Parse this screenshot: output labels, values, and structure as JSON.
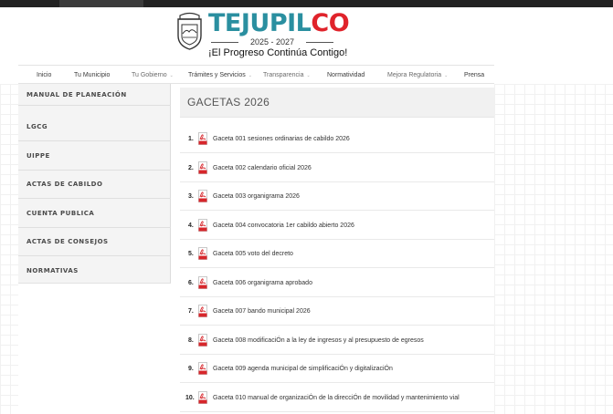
{
  "header": {
    "logo_brand_main": "TEJUPIL",
    "logo_brand_accent": "CO",
    "logo_years": "2025 - 2027",
    "logo_slogan": "¡El Progreso Continúa Contigo!"
  },
  "nav": {
    "items": [
      {
        "label": "Inicio"
      },
      {
        "label": "Tu Municipio"
      },
      {
        "label": "Tu Gobierno"
      },
      {
        "label": "Trámites y Servicios"
      },
      {
        "label": "Transparencia"
      },
      {
        "label": "Normatividad"
      },
      {
        "label": "Mejora Regulatoria"
      },
      {
        "label": "Prensa"
      }
    ]
  },
  "sidebar": {
    "items": [
      {
        "label": "MANUAL DE PLANEACIÓN"
      },
      {
        "label": "LGCG"
      },
      {
        "label": "UIPPE"
      },
      {
        "label": "ACTAS DE CABILDO"
      },
      {
        "label": "CUENTA PUBLICA"
      },
      {
        "label": "ACTAS DE CONSEJOS"
      },
      {
        "label": "NORMATIVAS"
      }
    ]
  },
  "main": {
    "title": "GACETAS 2026",
    "documents": [
      {
        "number": "1.",
        "title": "Gaceta 001 sesiones ordinarias de cabildo 2026",
        "icon": "pdf-icon"
      },
      {
        "number": "2.",
        "title": "Gaceta 002 calendario oficial 2026",
        "icon": "pdf-icon"
      },
      {
        "number": "3.",
        "title": "Gaceta 003 organigrama 2026",
        "icon": "pdf-icon"
      },
      {
        "number": "4.",
        "title": "Gaceta 004 convocatoria 1er cabildo abierto 2026",
        "icon": "pdf-icon"
      },
      {
        "number": "5.",
        "title": "Gaceta 005 voto del decreto",
        "icon": "pdf-icon"
      },
      {
        "number": "6.",
        "title": "Gaceta 006 organigrama aprobado",
        "icon": "pdf-icon"
      },
      {
        "number": "7.",
        "title": "Gaceta 007 bando municipal 2026",
        "icon": "pdf-icon"
      },
      {
        "number": "8.",
        "title": "Gaceta 008 modificaciÓn a la ley de ingresos y al presupuesto de egresos",
        "icon": "pdf-icon"
      },
      {
        "number": "9.",
        "title": "Gaceta 009 agenda municipal de simplificaciÓn y digitalizaciÓn",
        "icon": "pdf-icon"
      },
      {
        "number": "10.",
        "title": "Gaceta 010 manual de organizaciÓn de la direcciÓn de movilidad y mantenimiento vial",
        "icon": "pdf-icon"
      }
    ]
  },
  "colors": {
    "brand_teal": "#2a8fa0",
    "brand_red": "#e0232b",
    "pdf_red": "#d7262b",
    "top_bar": "#222222"
  }
}
